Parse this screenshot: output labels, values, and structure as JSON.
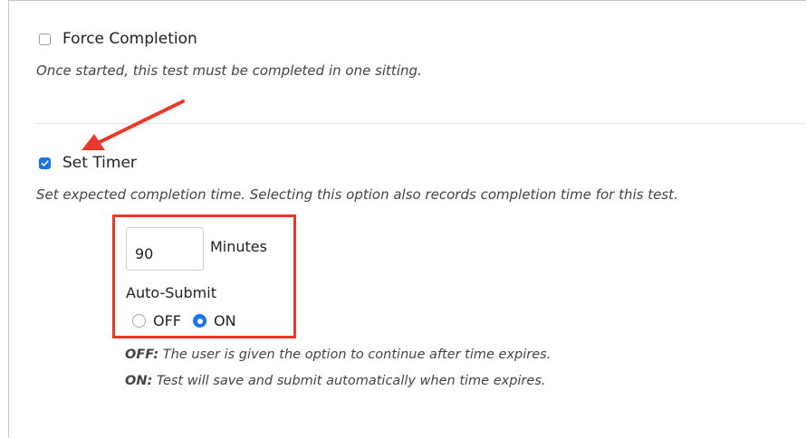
{
  "force_completion": {
    "label": "Force Completion",
    "checked": false,
    "description": "Once started, this test must be completed in one sitting."
  },
  "set_timer": {
    "label": "Set Timer",
    "checked": true,
    "description": "Set expected completion time. Selecting this option also records completion time for this test."
  },
  "timer": {
    "minutes_value": "90",
    "minutes_label": "Minutes",
    "auto_submit_label": "Auto-Submit",
    "off_label": "OFF",
    "on_label": "ON",
    "selected": "ON"
  },
  "help": {
    "off_key": "OFF:",
    "off_text": " The user is given the option to continue after time expires.",
    "on_key": "ON:",
    "on_text": " Test will save and submit automatically when time expires."
  },
  "colors": {
    "accent": "#1a73e8",
    "annotation": "#e8392b"
  }
}
